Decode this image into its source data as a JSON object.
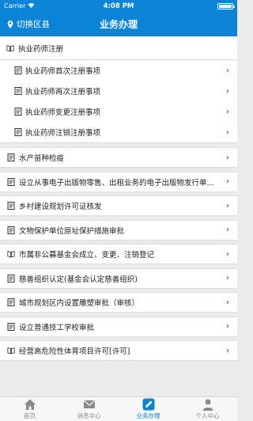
{
  "status_bar": {
    "carrier": "Carrier",
    "time": "4:08 PM",
    "battery_level": 1.0
  },
  "nav": {
    "region_label": "切换区县",
    "title": "业务办理"
  },
  "group": {
    "title": "执业药师注册",
    "items": [
      {
        "label": "执业药师首次注册事项"
      },
      {
        "label": "执业药师再次注册事项"
      },
      {
        "label": "执业药师变更注册事项"
      },
      {
        "label": "执业药师注销注册事项"
      }
    ]
  },
  "rows": [
    {
      "label": "水产苗种检疫"
    },
    {
      "label": "设立从事电子出版物零售、出租业务的电子出版物发行单..."
    },
    {
      "label": "乡村建设规划许可证核发"
    },
    {
      "label": "文物保护单位原址保护措施审批"
    },
    {
      "label": "市属非公募基金会成立、变更、注销登记"
    },
    {
      "label": "慈善组织认定(基金会认定慈善组织)"
    },
    {
      "label": "城市规划区内设置雕塑审批（审核）"
    },
    {
      "label": "设立普通技工学校审批"
    },
    {
      "label": "经营高危险性体育项目许可[许可]"
    }
  ],
  "tabs": [
    {
      "label": "首页",
      "icon": "home-icon"
    },
    {
      "label": "消息中心",
      "icon": "message-icon"
    },
    {
      "label": "业务办理",
      "icon": "edit-icon"
    },
    {
      "label": "个人中心",
      "icon": "user-icon"
    }
  ],
  "colors": {
    "primary": "#0a84d6",
    "background": "#ebebeb",
    "tab_inactive": "#8a8a8a"
  }
}
